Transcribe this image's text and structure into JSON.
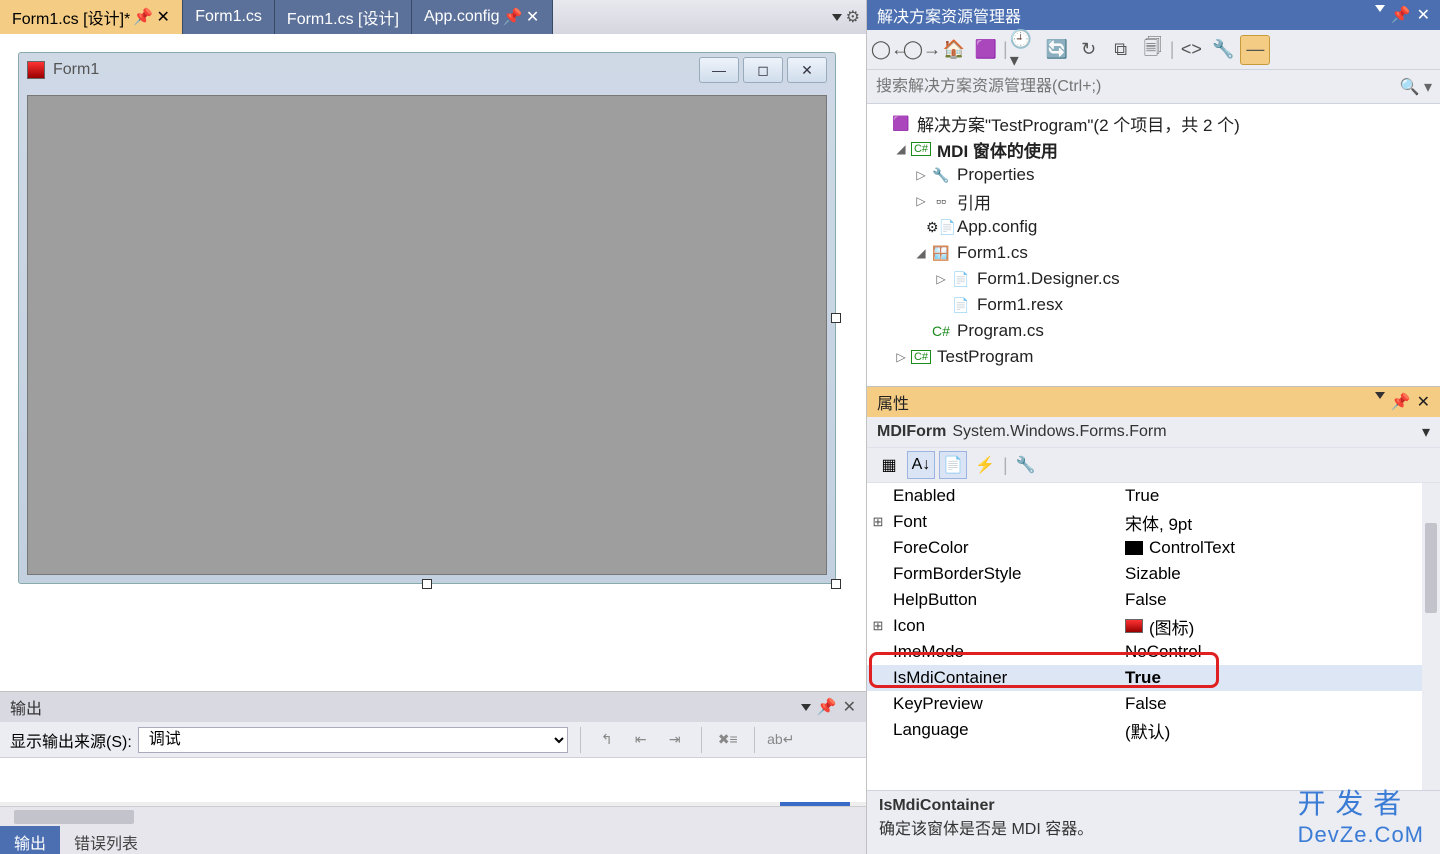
{
  "tabs": {
    "t0": "Form1.cs [设计]*",
    "t1": "Form1.cs",
    "t2": "Form1.cs [设计]",
    "t3": "App.config"
  },
  "designer": {
    "form_title": "Form1"
  },
  "output": {
    "header": "输出",
    "source_label": "显示输出来源(S):",
    "source_value": "调试",
    "bottom_tab_output": "输出",
    "bottom_tab_errors": "错误列表"
  },
  "solution": {
    "title": "解决方案资源管理器",
    "search_placeholder": "搜索解决方案资源管理器(Ctrl+;)",
    "nodes": {
      "sln": "解决方案\"TestProgram\"(2 个项目，共 2 个)",
      "proj1": "MDI 窗体的使用",
      "props": "Properties",
      "refs": "引用",
      "appcfg": "App.config",
      "form1": "Form1.cs",
      "form1d": "Form1.Designer.cs",
      "form1r": "Form1.resx",
      "program": "Program.cs",
      "proj2": "TestProgram"
    }
  },
  "props": {
    "title": "属性",
    "obj_name": "MDIForm",
    "obj_type": "System.Windows.Forms.Form",
    "rows": {
      "Enabled": "True",
      "Font": "宋体, 9pt",
      "ForeColor": "ControlText",
      "FormBorderStyle": "Sizable",
      "HelpButton": "False",
      "Icon": "(图标)",
      "ImeMode": "NoControl",
      "IsMdiContainer": "True",
      "KeyPreview": "False",
      "Language": "(默认)"
    },
    "desc_name": "IsMdiContainer",
    "desc_text": "确定该窗体是否是 MDI 容器。"
  },
  "watermark": {
    "line1": "开 发 者",
    "line2": "DevZe.CoM"
  }
}
